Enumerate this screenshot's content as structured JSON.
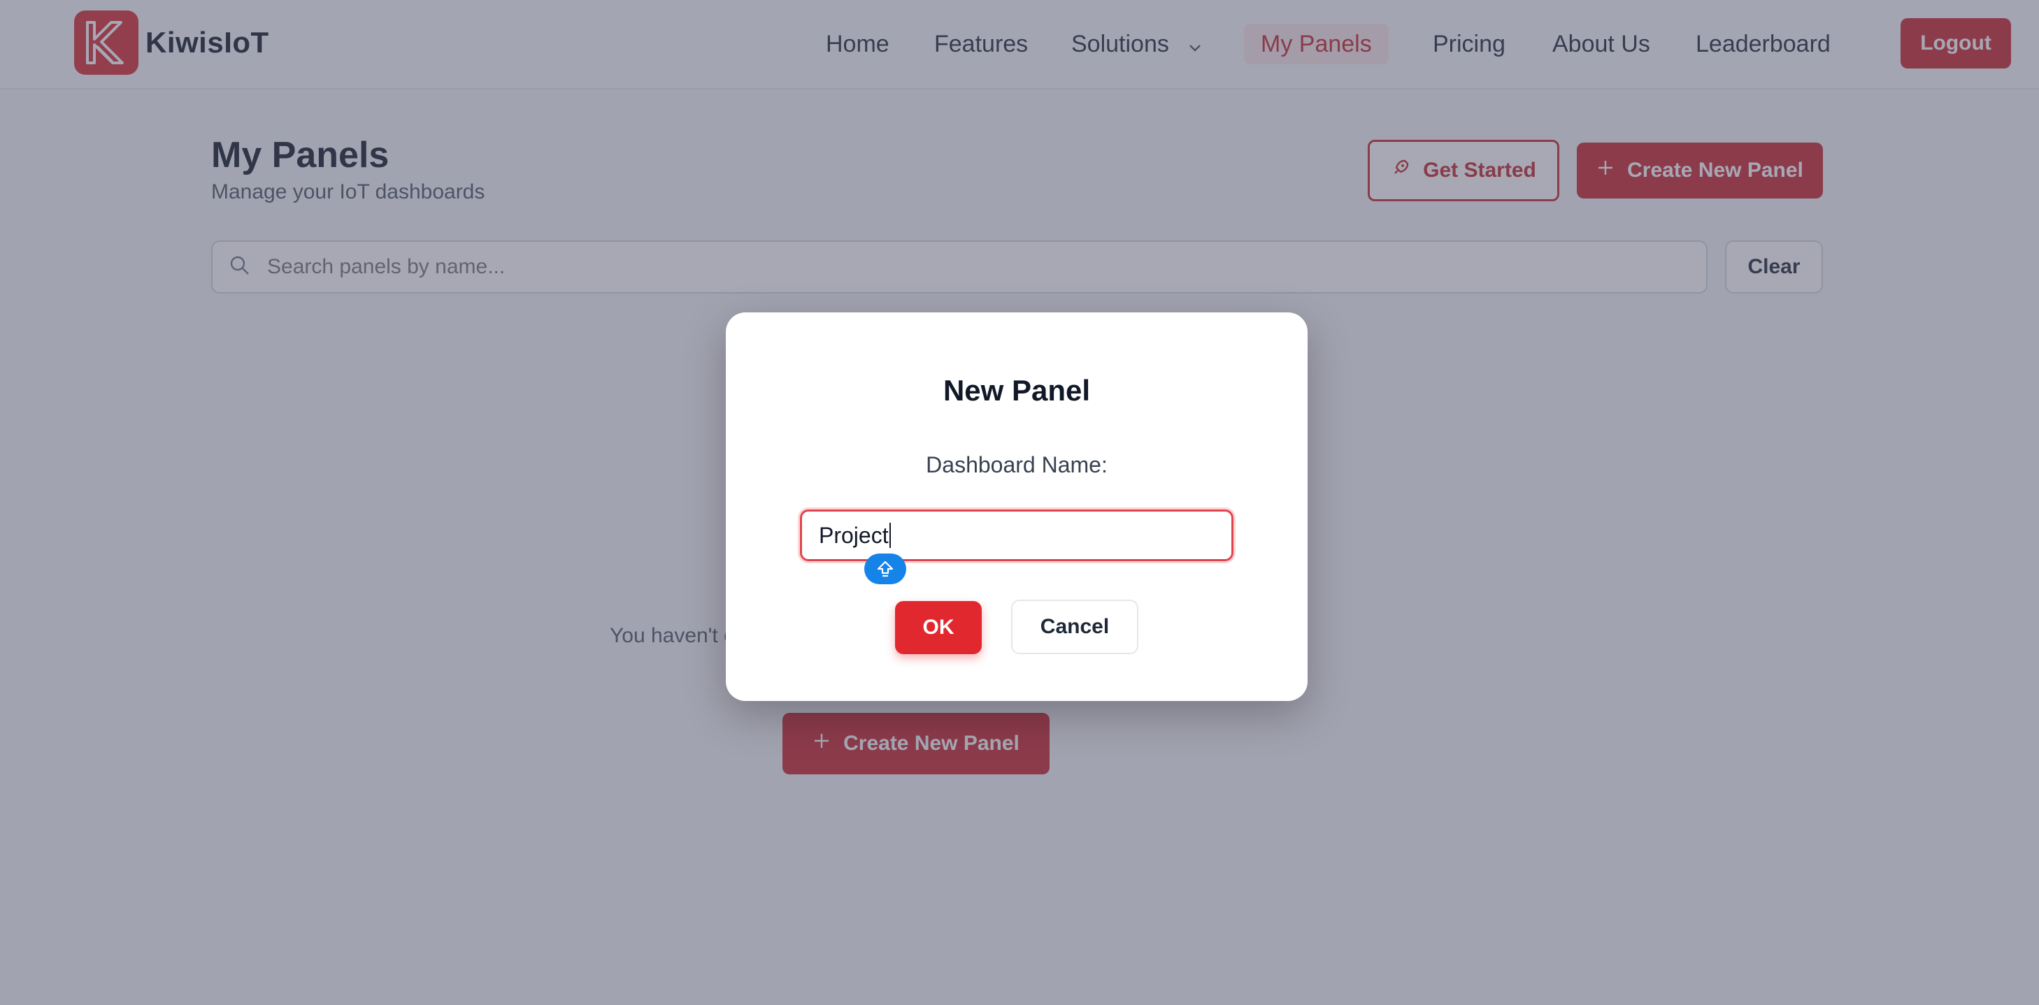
{
  "brand": {
    "name": "KiwisIoT",
    "logo_icon": "kiwis-logo-icon",
    "color": "#d42a31"
  },
  "nav": {
    "items": [
      {
        "label": "Home"
      },
      {
        "label": "Features"
      },
      {
        "label": "Solutions",
        "icon": "chevron-down-icon"
      },
      {
        "label": "My Panels",
        "active": true
      },
      {
        "label": "Pricing"
      },
      {
        "label": "About Us"
      },
      {
        "label": "Leaderboard"
      }
    ],
    "logout_label": "Logout"
  },
  "header": {
    "title": "My Panels",
    "subtitle": "Manage your IoT dashboards",
    "get_started_label": "Get Started",
    "get_started_icon": "rocket-icon",
    "create_label": "Create New Panel",
    "create_icon": "plus-icon"
  },
  "search": {
    "placeholder": "Search panels by name...",
    "clear_label": "Clear",
    "icon": "search-icon"
  },
  "empty_state": {
    "text_visible": "You haven't c",
    "create_label": "Create New Panel"
  },
  "modal": {
    "title": "New Panel",
    "label": "Dashboard Name:",
    "input_value": "Project",
    "ok_label": "OK",
    "cancel_label": "Cancel",
    "handle_icon": "shift-arrow-icon"
  },
  "colors": {
    "accent": "#c8252d",
    "ok_button": "#e0282e",
    "handle": "#1683e8"
  }
}
